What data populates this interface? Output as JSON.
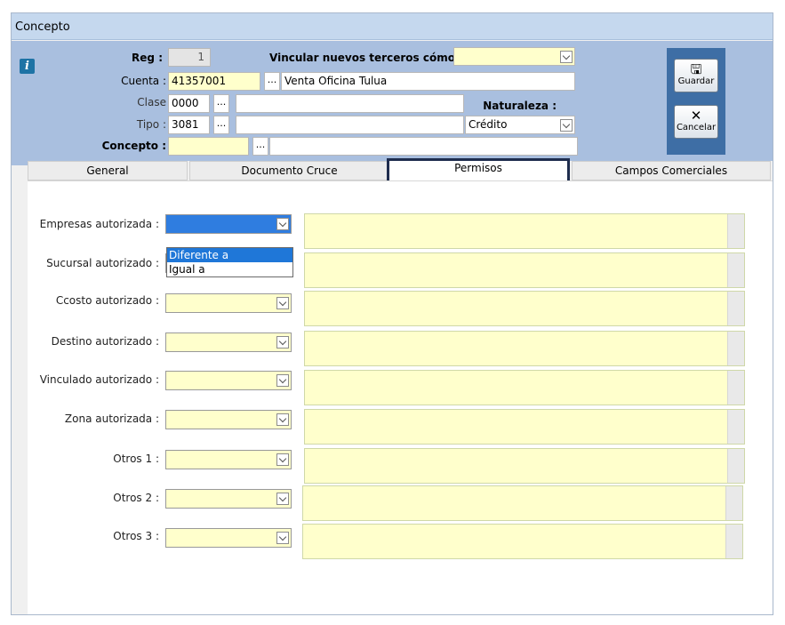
{
  "window": {
    "title": "Concepto"
  },
  "header": {
    "reg_label": "Reg :",
    "reg_value": "1",
    "vincular_label": "Vincular nuevos terceros cómo :",
    "vincular_value": "",
    "cuenta_label": "Cuenta :",
    "cuenta_code": "41357001",
    "cuenta_name": "Venta Oficina Tulua",
    "clase_label": "Clase",
    "clase_value": "0000",
    "clase_desc": "",
    "tipo_label": "Tipo :",
    "tipo_value": "3081",
    "tipo_desc": "",
    "naturaleza_label": "Naturaleza :",
    "naturaleza_value": "Crédito",
    "concepto_label": "Concepto :",
    "concepto_code": "",
    "concepto_desc": "",
    "ellipsis": "..."
  },
  "toolbar": {
    "save_label": "Guardar",
    "cancel_label": "Cancelar",
    "save_icon": "floppy-disk-icon",
    "cancel_icon": "x-icon"
  },
  "tabs": [
    {
      "label": "General",
      "active": false
    },
    {
      "label": "Documento Cruce",
      "active": false
    },
    {
      "label": "Permisos",
      "active": true
    },
    {
      "label": "Campos Comerciales",
      "active": false
    }
  ],
  "permisos": {
    "rows": [
      {
        "label": "Empresas autorizada :",
        "value": ""
      },
      {
        "label": "Sucursal autorizado :",
        "value": ""
      },
      {
        "label": "Ccosto autorizado :",
        "value": ""
      },
      {
        "label": "Destino autorizado :",
        "value": ""
      },
      {
        "label": "Vinculado autorizado :",
        "value": ""
      },
      {
        "label": "Zona autorizada :",
        "value": ""
      },
      {
        "label": "Otros 1 :",
        "value": ""
      },
      {
        "label": "Otros 2 :",
        "value": ""
      },
      {
        "label": "Otros 3 :",
        "value": ""
      }
    ],
    "dropdown_options": [
      "Diferente a",
      "Igual a"
    ],
    "dropdown_highlighted": "Diferente a"
  },
  "colors": {
    "header_bg": "#a9bfdf",
    "field_yellow": "#ffffcc",
    "selection_blue": "#1f77d8",
    "tab_highlight": "#1f2d4e"
  }
}
